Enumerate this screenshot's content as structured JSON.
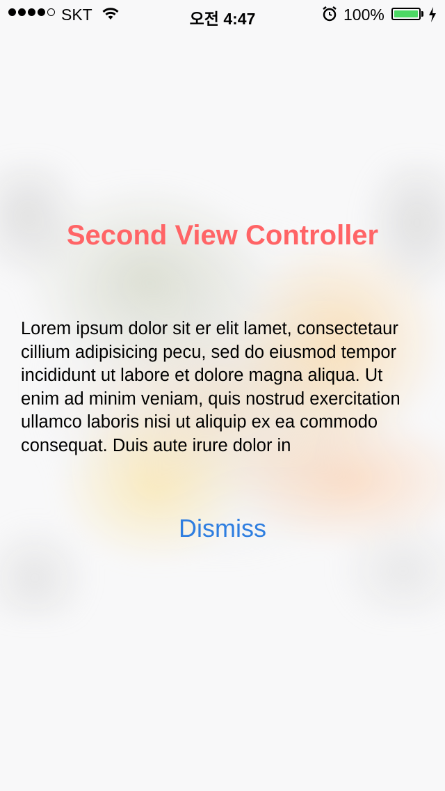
{
  "status_bar": {
    "carrier": "SKT",
    "time": "오전 4:47",
    "battery_percent": "100%",
    "battery_level": 1.0,
    "signal_bars_filled": 4,
    "signal_bars_total": 5,
    "icons": [
      "signal-dots-icon",
      "wifi-icon",
      "alarm-icon",
      "battery-icon",
      "charging-bolt-icon"
    ],
    "battery_color": "#4cd964"
  },
  "main": {
    "title": "Second View Controller",
    "title_color": "#ff6466",
    "body": "Lorem ipsum dolor sit er elit lamet, consectetaur cillium adipisicing pecu, sed do eiusmod tempor incididunt ut labore et dolore magna aliqua. Ut enim ad minim veniam, quis nostrud exercitation ullamco laboris nisi ut aliquip ex ea commodo consequat. Duis aute irure dolor in",
    "dismiss_label": "Dismiss",
    "dismiss_color": "#2e7ee0"
  }
}
